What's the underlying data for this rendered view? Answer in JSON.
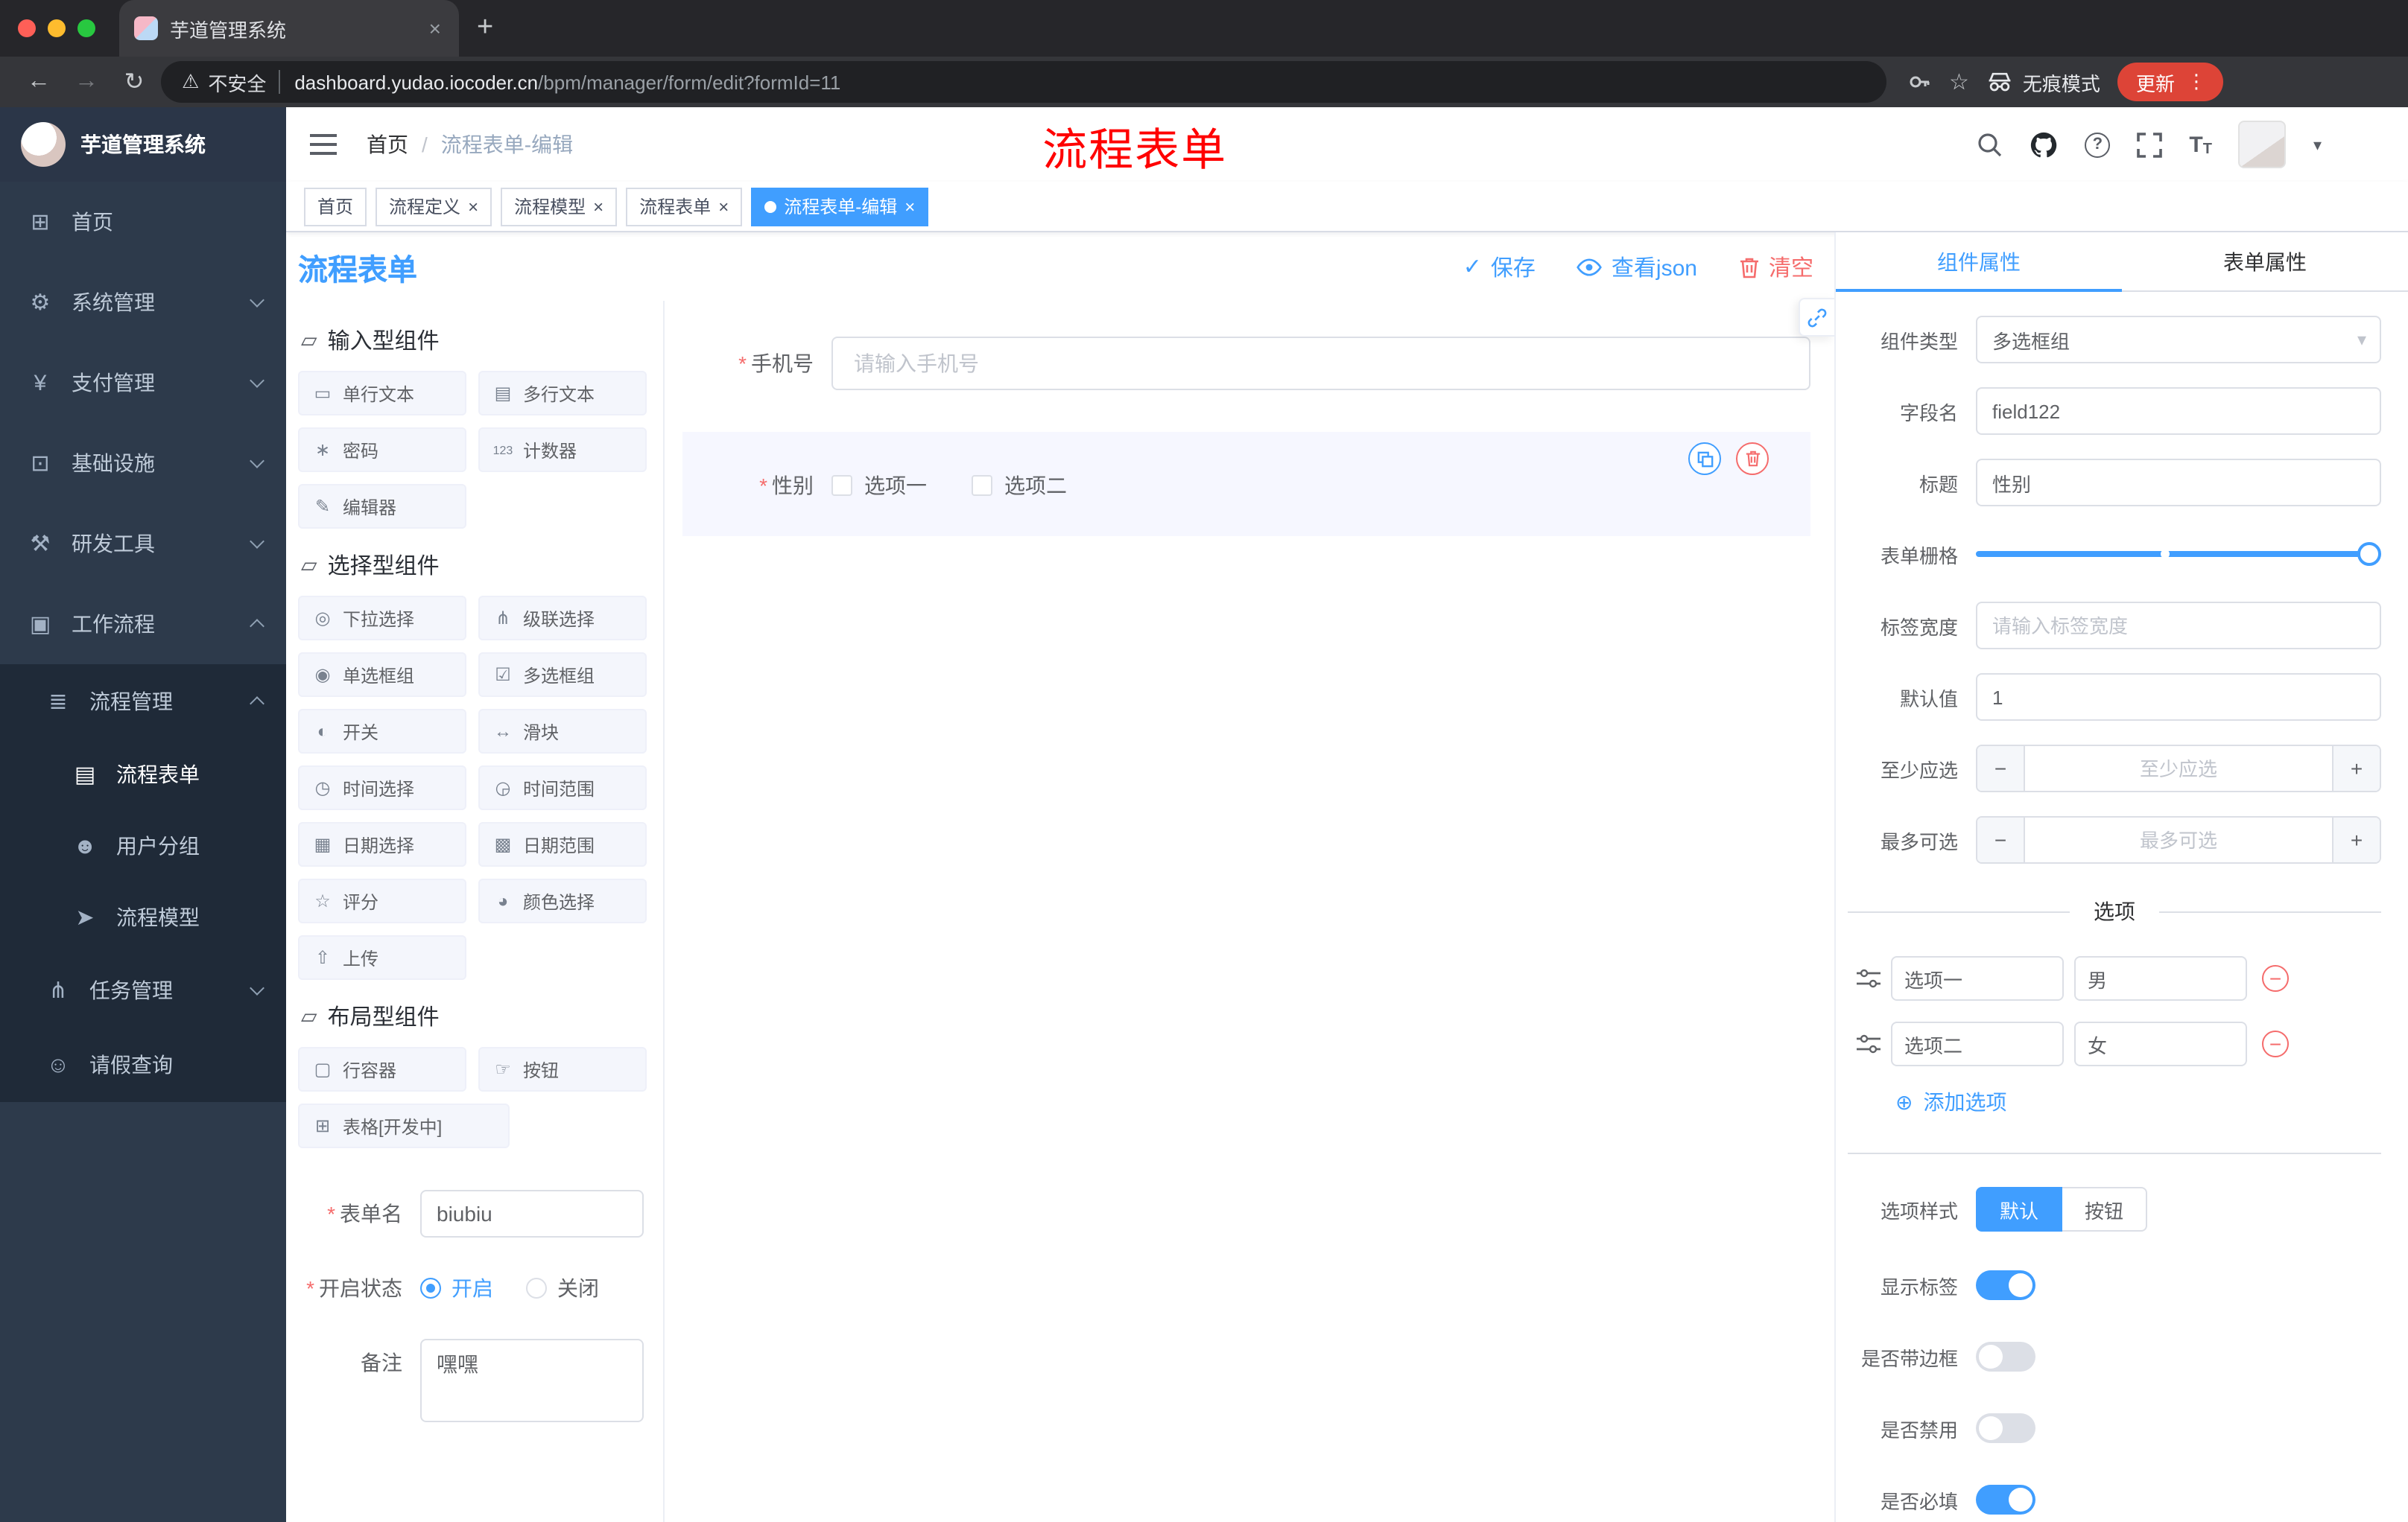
{
  "glyphs": {
    "back": "←",
    "forward": "→",
    "reload": "↻",
    "warning": "⚠",
    "star": "☆",
    "menu_dots": "⋮",
    "caret": "▾",
    "new_tab": "+",
    "close": "×",
    "check": "✓",
    "add": "⊕",
    "minus": "−",
    "plus": "+",
    "question": "?",
    "asterisk": "*",
    "text_icon": "T"
  },
  "browser": {
    "tab_title": "芋道管理系统",
    "security_label": "不安全",
    "url_domain": "dashboard.yudao.iocoder.cn",
    "url_path": "/bpm/manager/form/edit?formId=11",
    "incognito_label": "无痕模式",
    "update_label": "更新"
  },
  "sidebar": {
    "logo_title": "芋道管理系统",
    "menu": [
      {
        "icon": "⊞",
        "label": "首页"
      },
      {
        "icon": "⚙",
        "label": "系统管理"
      },
      {
        "icon": "¥",
        "label": "支付管理"
      },
      {
        "icon": "⊡",
        "label": "基础设施"
      },
      {
        "icon": "⚒",
        "label": "研发工具"
      },
      {
        "icon": "▣",
        "label": "工作流程"
      }
    ],
    "submenu": [
      {
        "icon": "≣",
        "label": "流程管理"
      },
      {
        "icon": "▤",
        "label": "流程表单"
      },
      {
        "icon": "☻",
        "label": "用户分组"
      },
      {
        "icon": "➤",
        "label": "流程模型"
      },
      {
        "icon": "⋔",
        "label": "任务管理"
      },
      {
        "icon": "☺",
        "label": "请假查询"
      }
    ]
  },
  "header": {
    "breadcrumb_home": "首页",
    "breadcrumb_sep": "/",
    "breadcrumb_current": "流程表单-编辑",
    "overlay_title": "流程表单"
  },
  "tags": [
    {
      "label": "首页"
    },
    {
      "label": "流程定义"
    },
    {
      "label": "流程模型"
    },
    {
      "label": "流程表单"
    },
    {
      "label": "流程表单-编辑"
    }
  ],
  "designer": {
    "title": "流程表单",
    "save_label": "保存",
    "view_json_label": "查看json",
    "clear_label": "清空",
    "groups": [
      {
        "icon": "▱",
        "title": "输入型组件",
        "items": [
          {
            "icon": "▭",
            "label": "单行文本"
          },
          {
            "icon": "▤",
            "label": "多行文本"
          },
          {
            "icon": "∗",
            "label": "密码"
          },
          {
            "icon": "123",
            "label": "计数器"
          },
          {
            "icon": "✎",
            "label": "编辑器"
          }
        ]
      },
      {
        "icon": "▱",
        "title": "选择型组件",
        "items": [
          {
            "icon": "◎",
            "label": "下拉选择"
          },
          {
            "icon": "⋔",
            "label": "级联选择"
          },
          {
            "icon": "◉",
            "label": "单选框组"
          },
          {
            "icon": "☑",
            "label": "多选框组"
          },
          {
            "icon": "◐",
            "label": "开关"
          },
          {
            "icon": "↔",
            "label": "滑块"
          },
          {
            "icon": "◷",
            "label": "时间选择"
          },
          {
            "icon": "◶",
            "label": "时间范围"
          },
          {
            "icon": "▦",
            "label": "日期选择"
          },
          {
            "icon": "▩",
            "label": "日期范围"
          },
          {
            "icon": "☆",
            "label": "评分"
          },
          {
            "icon": "◕",
            "label": "颜色选择"
          },
          {
            "icon": "⇧",
            "label": "上传"
          }
        ]
      },
      {
        "icon": "▱",
        "title": "布局型组件",
        "items": [
          {
            "icon": "▢",
            "label": "行容器"
          },
          {
            "icon": "☞",
            "label": "按钮"
          },
          {
            "icon": "⊞",
            "label": "表格[开发中]"
          }
        ]
      }
    ],
    "meta": {
      "name_label": "表单名",
      "name_value": "biubiu",
      "status_label": "开启状态",
      "status_on": "开启",
      "status_off": "关闭",
      "remark_label": "备注",
      "remark_value": "嘿嘿"
    },
    "canvas": {
      "phone_label": "手机号",
      "phone_placeholder": "请输入手机号",
      "gender_label": "性别",
      "gender_options": [
        "选项一",
        "选项二"
      ]
    }
  },
  "panel": {
    "tab_component": "组件属性",
    "tab_form": "表单属性",
    "rows": {
      "type_label": "组件类型",
      "type_value": "多选框组",
      "field_label": "字段名",
      "field_value": "field122",
      "title_label": "标题",
      "title_value": "性别",
      "grid_label": "表单栅格",
      "width_label": "标签宽度",
      "width_placeholder": "请输入标签宽度",
      "default_label": "默认值",
      "default_value": "1",
      "min_label": "至少应选",
      "min_placeholder": "至少应选",
      "max_label": "最多可选",
      "max_placeholder": "最多可选"
    },
    "options": {
      "divider": "选项",
      "rows": [
        {
          "label": "选项一",
          "value": "男"
        },
        {
          "label": "选项二",
          "value": "女"
        }
      ],
      "add_label": "添加选项"
    },
    "style": {
      "label": "选项样式",
      "default_btn": "默认",
      "button_btn": "按钮"
    },
    "switches": [
      {
        "label": "显示标签",
        "on": true
      },
      {
        "label": "是否带边框",
        "on": false
      },
      {
        "label": "是否禁用",
        "on": false
      },
      {
        "label": "是否必填",
        "on": true
      }
    ],
    "colors": {
      "accent": "#409eff",
      "danger": "#f56c6c"
    }
  }
}
